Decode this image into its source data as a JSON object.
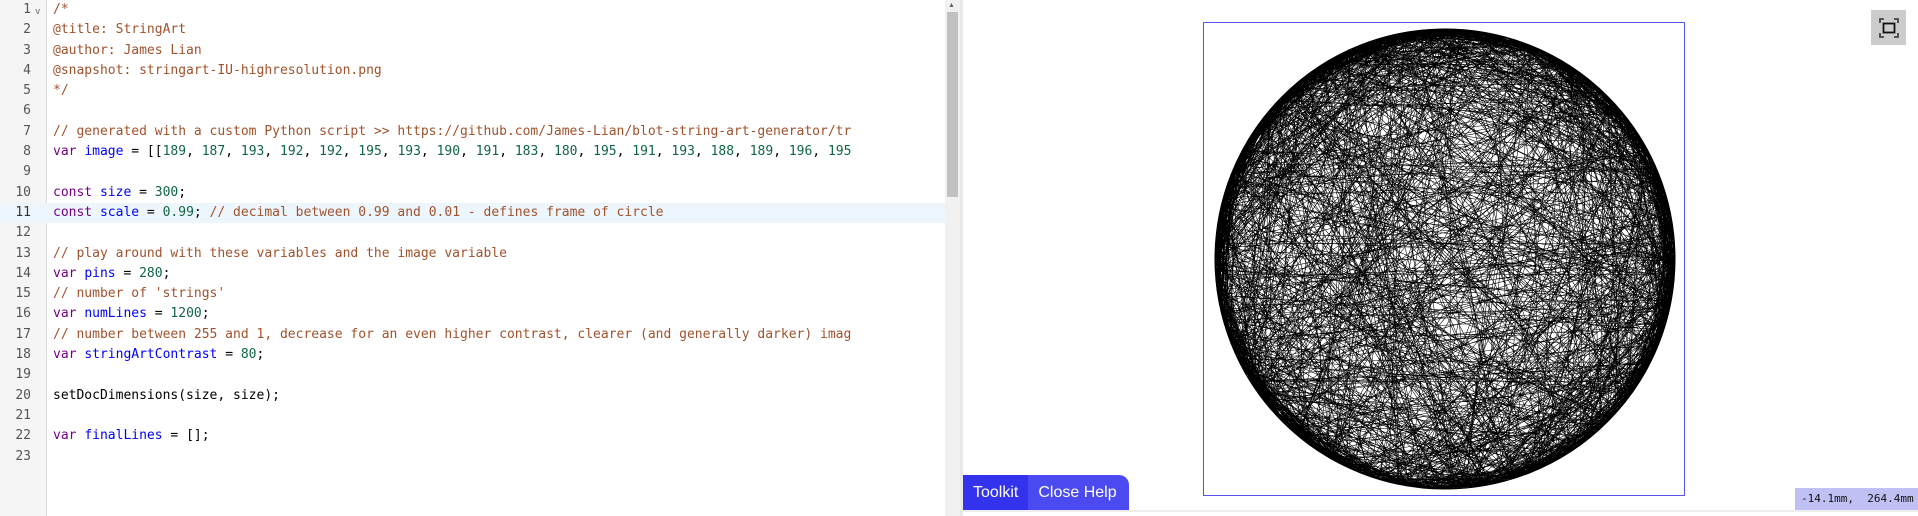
{
  "editor": {
    "active_line": 11,
    "lines": [
      [
        {
          "t": "/*",
          "c": "comment"
        }
      ],
      [
        {
          "t": "@title: StringArt",
          "c": "comment"
        }
      ],
      [
        {
          "t": "@author: James Lian",
          "c": "comment"
        }
      ],
      [
        {
          "t": "@snapshot: stringart-IU-highresolution.png",
          "c": "comment"
        }
      ],
      [
        {
          "t": "*/",
          "c": "comment"
        }
      ],
      [],
      [
        {
          "t": "// generated with a custom Python script >> https://github.com/James-Lian/blot-string-art-generator/tr",
          "c": "comment"
        }
      ],
      [
        {
          "t": "var ",
          "c": "kw"
        },
        {
          "t": "image",
          "c": "var"
        },
        {
          "t": " = [[",
          "c": "plain"
        },
        {
          "t": "189",
          "c": "num"
        },
        {
          "t": ", ",
          "c": "plain"
        },
        {
          "t": "187",
          "c": "num"
        },
        {
          "t": ", ",
          "c": "plain"
        },
        {
          "t": "193",
          "c": "num"
        },
        {
          "t": ", ",
          "c": "plain"
        },
        {
          "t": "192",
          "c": "num"
        },
        {
          "t": ", ",
          "c": "plain"
        },
        {
          "t": "192",
          "c": "num"
        },
        {
          "t": ", ",
          "c": "plain"
        },
        {
          "t": "195",
          "c": "num"
        },
        {
          "t": ", ",
          "c": "plain"
        },
        {
          "t": "193",
          "c": "num"
        },
        {
          "t": ", ",
          "c": "plain"
        },
        {
          "t": "190",
          "c": "num"
        },
        {
          "t": ", ",
          "c": "plain"
        },
        {
          "t": "191",
          "c": "num"
        },
        {
          "t": ", ",
          "c": "plain"
        },
        {
          "t": "183",
          "c": "num"
        },
        {
          "t": ", ",
          "c": "plain"
        },
        {
          "t": "180",
          "c": "num"
        },
        {
          "t": ", ",
          "c": "plain"
        },
        {
          "t": "195",
          "c": "num"
        },
        {
          "t": ", ",
          "c": "plain"
        },
        {
          "t": "191",
          "c": "num"
        },
        {
          "t": ", ",
          "c": "plain"
        },
        {
          "t": "193",
          "c": "num"
        },
        {
          "t": ", ",
          "c": "plain"
        },
        {
          "t": "188",
          "c": "num"
        },
        {
          "t": ", ",
          "c": "plain"
        },
        {
          "t": "189",
          "c": "num"
        },
        {
          "t": ", ",
          "c": "plain"
        },
        {
          "t": "196",
          "c": "num"
        },
        {
          "t": ", ",
          "c": "plain"
        },
        {
          "t": "195",
          "c": "num"
        }
      ],
      [],
      [
        {
          "t": "const ",
          "c": "kw"
        },
        {
          "t": "size",
          "c": "var"
        },
        {
          "t": " = ",
          "c": "plain"
        },
        {
          "t": "300",
          "c": "num"
        },
        {
          "t": ";",
          "c": "plain"
        }
      ],
      [
        {
          "t": "const ",
          "c": "kw"
        },
        {
          "t": "scale",
          "c": "var"
        },
        {
          "t": " = ",
          "c": "plain"
        },
        {
          "t": "0.99",
          "c": "num"
        },
        {
          "t": "; ",
          "c": "plain"
        },
        {
          "t": "// decimal between 0.99 and 0.01 - defines frame of circle",
          "c": "comment"
        }
      ],
      [],
      [
        {
          "t": "// play around with these variables and the image variable",
          "c": "comment"
        }
      ],
      [
        {
          "t": "var ",
          "c": "kw"
        },
        {
          "t": "pins",
          "c": "var"
        },
        {
          "t": " = ",
          "c": "plain"
        },
        {
          "t": "280",
          "c": "num"
        },
        {
          "t": ";",
          "c": "plain"
        }
      ],
      [
        {
          "t": "// number of 'strings'",
          "c": "comment"
        }
      ],
      [
        {
          "t": "var ",
          "c": "kw"
        },
        {
          "t": "numLines",
          "c": "var"
        },
        {
          "t": " = ",
          "c": "plain"
        },
        {
          "t": "1200",
          "c": "num"
        },
        {
          "t": ";",
          "c": "plain"
        }
      ],
      [
        {
          "t": "// number between 255 and 1, decrease for an even higher contrast, clearer (and generally darker) imag",
          "c": "comment"
        }
      ],
      [
        {
          "t": "var ",
          "c": "kw"
        },
        {
          "t": "stringArtContrast",
          "c": "var"
        },
        {
          "t": " = ",
          "c": "plain"
        },
        {
          "t": "80",
          "c": "num"
        },
        {
          "t": ";",
          "c": "plain"
        }
      ],
      [],
      [
        {
          "t": "setDocDimensions(size, size);",
          "c": "plain"
        }
      ],
      [],
      [
        {
          "t": "var ",
          "c": "kw"
        },
        {
          "t": "finalLines",
          "c": "var"
        },
        {
          "t": " = [];",
          "c": "plain"
        }
      ],
      []
    ]
  },
  "viewer": {
    "fit_icon": "fit-to-screen-icon",
    "toolkit_label": "Toolkit",
    "close_help_label": "Close Help",
    "coords": "-14.1mm,  264.4mm",
    "frame_color": "#5555ee",
    "accent": "#3333ee"
  }
}
